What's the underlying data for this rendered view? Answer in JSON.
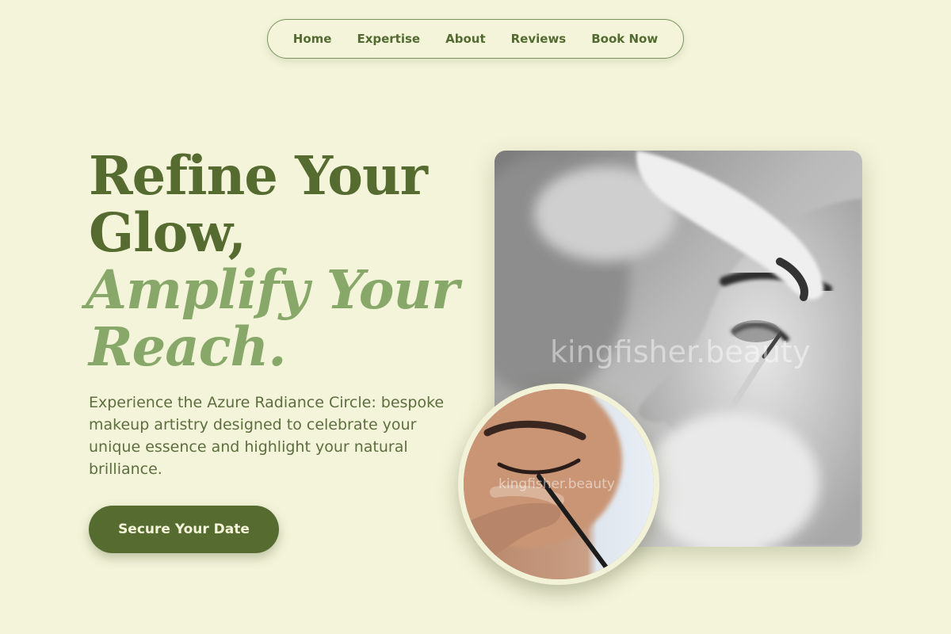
{
  "nav": {
    "items": [
      {
        "label": "Home"
      },
      {
        "label": "Expertise"
      },
      {
        "label": "About"
      },
      {
        "label": "Reviews"
      },
      {
        "label": "Book Now"
      }
    ]
  },
  "hero": {
    "headline_line1": "Refine Your",
    "headline_line2": "Glow,",
    "headline_line3": "Amplify Your",
    "headline_line4": "Reach.",
    "description": "Experience the Azure Radiance Circle: bespoke makeup artistry designed to celebrate your unique essence and highlight your natural brilliance.",
    "cta_label": "Secure Your Date"
  },
  "images": {
    "main_watermark": "kingfisher.beauty",
    "circle_watermark": "kingfisher.beauty"
  },
  "colors": {
    "background": "#f4f4da",
    "primary": "#566b30",
    "accent": "#88a86a"
  }
}
